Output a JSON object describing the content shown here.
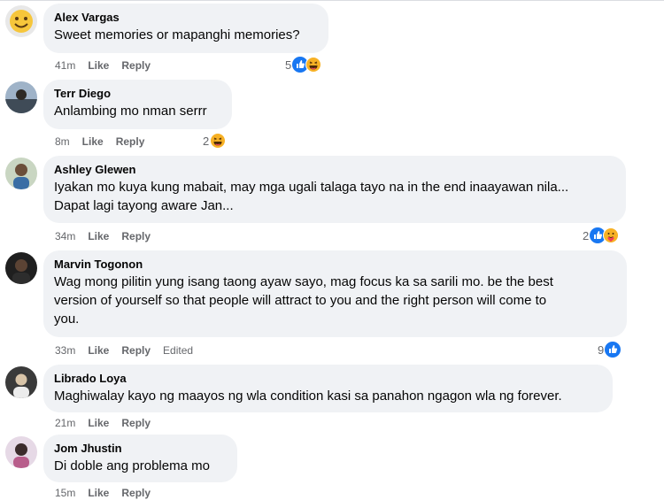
{
  "comments": [
    {
      "author": "Alex Vargas",
      "text": "Sweet memories or mapanghi memories?",
      "time": "41m",
      "like": "Like",
      "reply": "Reply",
      "reactions": "5",
      "reaction_icons": [
        "like-icon",
        "haha-icon"
      ]
    },
    {
      "author": "Terr Diego",
      "text": "Anlambing mo nman serrr",
      "time": "8m",
      "like": "Like",
      "reply": "Reply",
      "reactions": "2",
      "reaction_icons": [
        "haha-icon"
      ]
    },
    {
      "author": "Ashley Glewen",
      "text_line1": "Iyakan mo kuya kung mabait, may mga ugali talaga tayo na in the end inaayawan nila...",
      "text_line2": "Dapat lagi tayong aware Jan...",
      "time": "34m",
      "like": "Like",
      "reply": "Reply",
      "reactions": "2",
      "reaction_icons": [
        "like-icon",
        "care-icon"
      ]
    },
    {
      "author": "Marvin Togonon",
      "text_line1": "Wag mong pilitin yung isang taong ayaw sayo, mag focus ka sa sarili mo. be the best",
      "text_line2": "version of yourself so that people will attract to you and the right person will come to",
      "text_line3": "you.",
      "time": "33m",
      "like": "Like",
      "reply": "Reply",
      "edited": "Edited",
      "reactions": "9",
      "reaction_icons": [
        "like-icon"
      ]
    },
    {
      "author": "Librado Loya",
      "text": "Maghiwalay kayo ng maayos ng wla condition kasi sa panahon ngagon wla ng forever.",
      "time": "21m",
      "like": "Like",
      "reply": "Reply"
    },
    {
      "author": "Jom Jhustin",
      "text": "Di doble ang problema mo",
      "time": "15m",
      "like": "Like",
      "reply": "Reply"
    }
  ],
  "colors": {
    "bubble": "#f0f2f5",
    "meta": "#65676b",
    "like_blue": "#1877f2",
    "haha_yellow": "#f7b125"
  }
}
